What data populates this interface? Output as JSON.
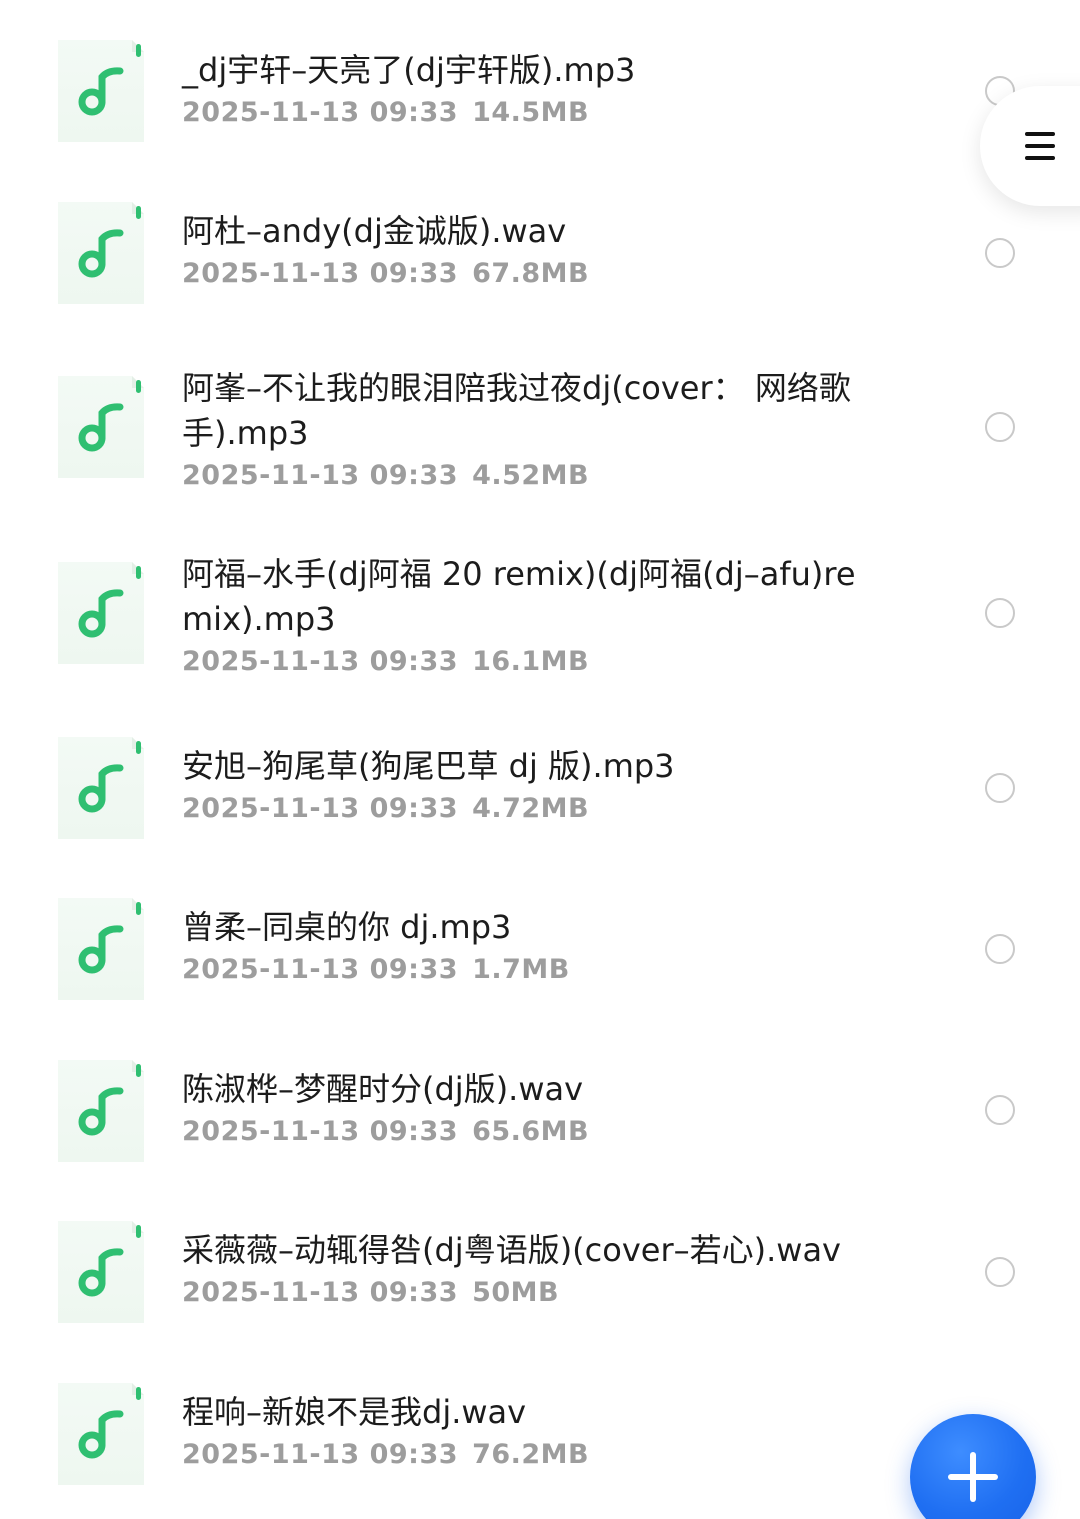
{
  "files": [
    {
      "name": "_dj宇轩–天亮了(dj宇轩版).mp3",
      "date": "2025-11-13 09:33",
      "size": "14.5MB",
      "selected": false
    },
    {
      "name": "阿杜–andy(dj金诚版).wav",
      "date": "2025-11-13 09:33",
      "size": "67.8MB",
      "selected": false
    },
    {
      "name": "阿峯–不让我的眼泪陪我过夜dj(cover：  网络歌手).mp3",
      "date": "2025-11-13 09:33",
      "size": "4.52MB",
      "selected": false
    },
    {
      "name": "阿福–水手(dj阿福 20 remix)(dj阿福(dj–afu)remix).mp3",
      "date": "2025-11-13 09:33",
      "size": "16.1MB",
      "selected": false
    },
    {
      "name": "安旭–狗尾草(狗尾巴草 dj 版).mp3",
      "date": "2025-11-13 09:33",
      "size": "4.72MB",
      "selected": false
    },
    {
      "name": "曾柔–同桌的你 dj.mp3",
      "date": "2025-11-13 09:33",
      "size": "1.7MB",
      "selected": false
    },
    {
      "name": "陈淑桦–梦醒时分(dj版).wav",
      "date": "2025-11-13 09:33",
      "size": "65.6MB",
      "selected": false
    },
    {
      "name": "采薇薇–动辄得咎(dj粤语版)(cover–若心).wav",
      "date": "2025-11-13 09:33",
      "size": "50MB",
      "selected": false
    },
    {
      "name": "程响–新娘不是我dj.wav",
      "date": "2025-11-13 09:33",
      "size": "76.2MB",
      "selected": false
    }
  ],
  "icons": {
    "file": "music-note-icon",
    "menu": "hamburger-menu-icon",
    "fab": "plus-icon"
  },
  "colors": {
    "icon_green": "#2fbf71",
    "icon_bg": "#eef7f0",
    "fab_blue": "#1f6ff2",
    "meta_gray": "#9d9d9d"
  }
}
